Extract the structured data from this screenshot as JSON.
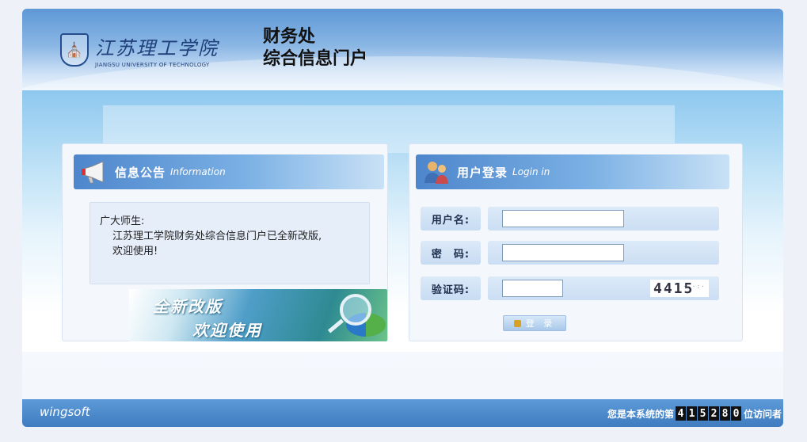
{
  "header": {
    "school_name_cn": "江苏理工学院",
    "school_name_en": "JIANGSU UNIVERSITY OF TECHNOLOGY",
    "portal_title_line1": "财务处",
    "portal_title_line2": "综合信息门户"
  },
  "notice": {
    "title": "信息公告",
    "title_en": "Information",
    "greeting": "广大师生:",
    "line1": "江苏理工学院财务处综合信息门户已全新改版,",
    "line2": "欢迎使用!",
    "banner_line1": "全新改版",
    "banner_line2": "欢迎使用"
  },
  "login": {
    "title": "用户登录",
    "title_en": "Login in",
    "username_label": "用户名:",
    "password_label": "密　码:",
    "captcha_label": "验证码:",
    "username_value": "",
    "password_value": "",
    "captcha_value": "",
    "captcha_image_text": "4415",
    "submit_label": "登 录"
  },
  "footer": {
    "brand": "wingsoft",
    "visitor_prefix": "您是本系统的第",
    "visitor_count": [
      "4",
      "1",
      "5",
      "2",
      "8",
      "0"
    ],
    "visitor_suffix": "位访问者"
  },
  "icons": {
    "notice_icon": "megaphone-icon",
    "login_icon": "users-icon",
    "button_icon": "lock-icon"
  }
}
